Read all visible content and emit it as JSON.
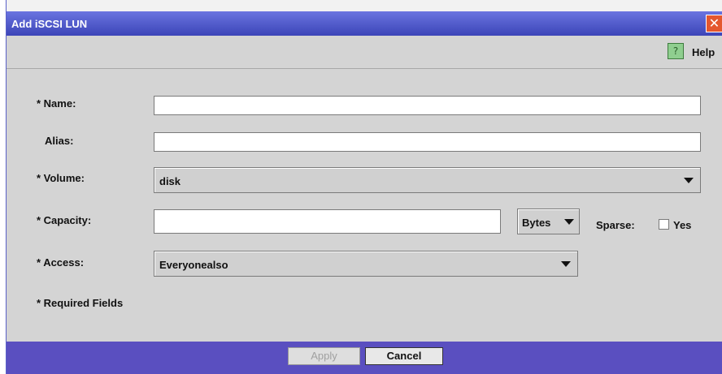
{
  "dialog": {
    "title": "Add iSCSI LUN",
    "close_glyph": "✕"
  },
  "toolbar": {
    "help_icon": "question-mark-icon",
    "help_glyph": "?",
    "help_label": "Help"
  },
  "form": {
    "name_label": "* Name:",
    "name_value": "",
    "alias_label": "Alias:",
    "alias_value": "",
    "volume_label": "* Volume:",
    "volume_value": "disk",
    "capacity_label": "* Capacity:",
    "capacity_value": "",
    "capacity_unit": "Bytes",
    "sparse_label": "Sparse:",
    "sparse_checked": false,
    "sparse_option": "Yes",
    "access_label": "* Access:",
    "access_value": "Everyonealso",
    "required_note": "* Required Fields"
  },
  "footer": {
    "apply_label": "Apply",
    "apply_enabled": false,
    "cancel_label": "Cancel"
  },
  "colors": {
    "titlebar": "#3c45b8",
    "footer": "#5a4fc0",
    "close_button": "#e4572e",
    "dialog_bg": "#d4d4d4"
  }
}
